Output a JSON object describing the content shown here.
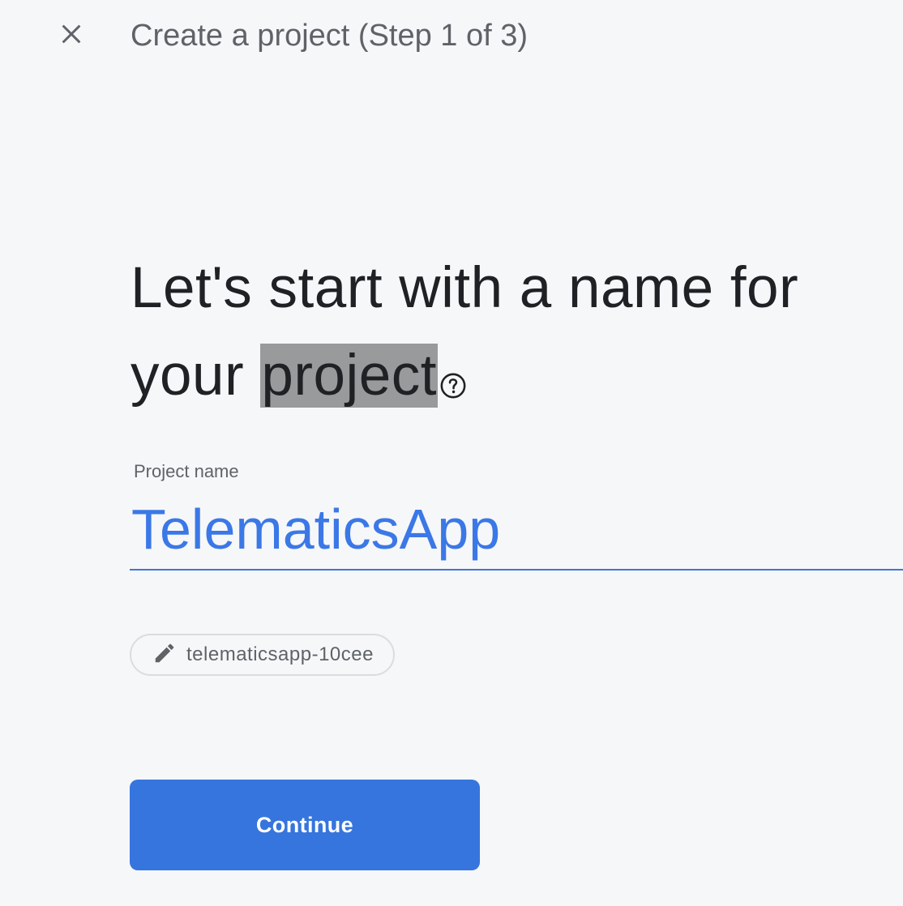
{
  "header": {
    "title": "Create a project (Step 1 of 3)",
    "close_icon": "close-icon"
  },
  "main": {
    "headline_prefix": "Let's start with a name for your ",
    "headline_highlight": "project",
    "help_icon": "help-circle-icon",
    "field": {
      "label": "Project name",
      "value": "TelematicsApp"
    },
    "project_id_chip": {
      "icon": "pencil-icon",
      "label": "telematicsapp-10cee"
    },
    "continue_label": "Continue"
  },
  "colors": {
    "accent": "#3675dd",
    "input_text": "#3b78e7",
    "highlight": "#999a9b",
    "background": "#f6f7f9"
  }
}
